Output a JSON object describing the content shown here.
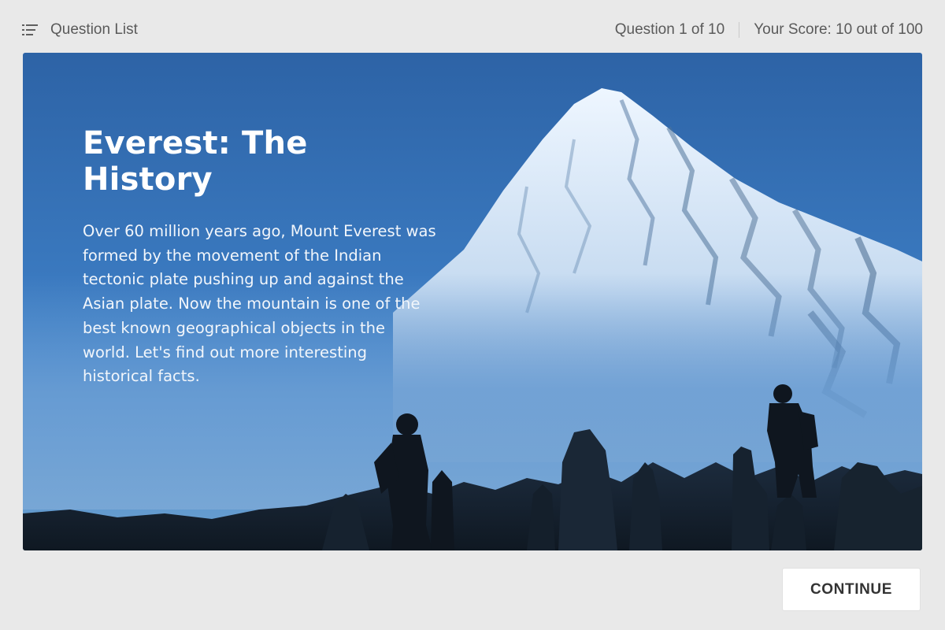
{
  "header": {
    "question_list_label": "Question List",
    "question_progress": "Question 1 of 10",
    "score": "Your Score: 10 out of 100"
  },
  "hero": {
    "title": "Everest: The History",
    "body": "Over 60 million years ago, Mount Everest was formed by the movement of the Indian tectonic plate pushing up and against the Asian plate. Now the mountain is one of the best known geographical objects in the world. Let's find out more interesting historical facts."
  },
  "footer": {
    "continue_label": "CONTINUE"
  },
  "icons": {
    "question_list": "list-icon"
  },
  "colors": {
    "page_background": "#e9e9e9",
    "hero_sky": "#3a79bf",
    "button_background": "#ffffff"
  }
}
